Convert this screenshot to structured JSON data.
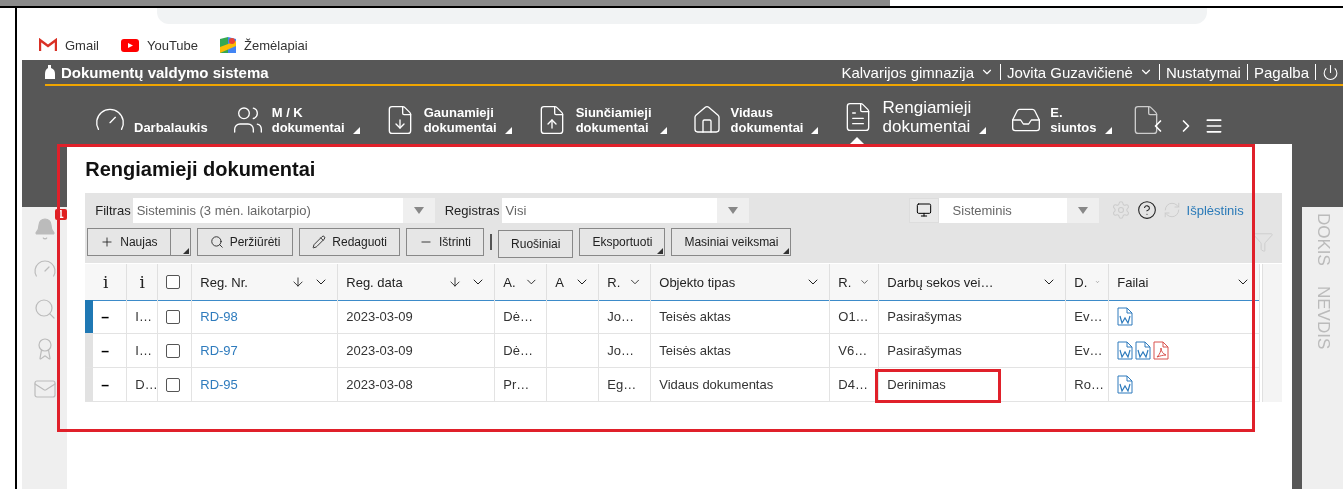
{
  "bookmarks": [
    {
      "label": "Gmail"
    },
    {
      "label": "YouTube"
    },
    {
      "label": "Žemėlapiai"
    }
  ],
  "app": {
    "title": "Dokumentų valdymo sistema",
    "header_links": [
      {
        "label": "Kalvarijos gimnazija",
        "dropdown": true
      },
      {
        "label": "Jovita Guzavičienė",
        "dropdown": true
      },
      {
        "label": "Nustatymai",
        "dropdown": false
      },
      {
        "label": "Pagalba",
        "dropdown": false
      }
    ]
  },
  "nav": [
    {
      "lines": [
        "Darbalaukis"
      ],
      "dropdown": false,
      "selected": false
    },
    {
      "lines": [
        "M / K",
        "dokumentai"
      ],
      "dropdown": true,
      "selected": false
    },
    {
      "lines": [
        "Gaunamieji",
        "dokumentai"
      ],
      "dropdown": true,
      "selected": false
    },
    {
      "lines": [
        "Siunčiamieji",
        "dokumentai"
      ],
      "dropdown": true,
      "selected": false
    },
    {
      "lines": [
        "Vidaus",
        "dokumentai"
      ],
      "dropdown": true,
      "selected": false
    },
    {
      "lines": [
        "Rengiamieji",
        "dokumentai"
      ],
      "dropdown": true,
      "selected": true
    },
    {
      "lines": [
        "E.",
        "siuntos"
      ],
      "dropdown": true,
      "selected": false
    }
  ],
  "sidebar": {
    "notification_badge": "1"
  },
  "right_sidebar": [
    "DOKIS",
    "NEVDIS"
  ],
  "page_title": "Rengiamieji dokumentai",
  "filters": {
    "filter_label": "Filtras",
    "filter_value": "Sisteminis (3 mėn. laikotarpio)",
    "register_label": "Registras",
    "register_value": "Visi",
    "view_value": "Sisteminis",
    "advanced_link": "Išplėstinis"
  },
  "toolbar": [
    {
      "label": "Naujas",
      "kind": "split"
    },
    {
      "label": "Peržiūrėti",
      "kind": "plain"
    },
    {
      "label": "Redaguoti",
      "kind": "plain"
    },
    {
      "label": "Ištrinti",
      "kind": "plain"
    },
    {
      "label": "Ruošiniai",
      "kind": "separated"
    },
    {
      "label": "Eksportuoti",
      "kind": "menu"
    },
    {
      "label": "Masiniai veiksmai",
      "kind": "menu"
    }
  ],
  "table": {
    "columns": [
      {
        "label": "i",
        "kind": "info"
      },
      {
        "label": "i",
        "kind": "info"
      },
      {
        "kind": "checkbox",
        "checked": false
      },
      {
        "label": "Reg. Nr.",
        "kind": "text",
        "sorted": true
      },
      {
        "label": "Reg. data",
        "kind": "text",
        "sorted": true
      },
      {
        "label": "A.",
        "kind": "text",
        "sorted": false
      },
      {
        "label": "A",
        "kind": "text",
        "sorted": false
      },
      {
        "label": "R.",
        "kind": "text",
        "sorted": false
      },
      {
        "label": "Objekto tipas",
        "kind": "text",
        "sorted": false
      },
      {
        "label": "R.",
        "kind": "text",
        "sorted": false
      },
      {
        "label": "Darbų sekos vei…",
        "kind": "text",
        "sorted": false
      },
      {
        "label": "D.",
        "kind": "text",
        "sorted": false
      },
      {
        "label": "Failai",
        "kind": "text",
        "sorted": false
      }
    ],
    "rows": [
      {
        "selected": true,
        "checked": false,
        "cells": [
          "–",
          "I…",
          "",
          "RD-98",
          "2023-03-09",
          "Dė…",
          "",
          "Jo…",
          "Teisės aktas",
          "O1…",
          "Pasirašymas",
          "Ev…",
          ""
        ],
        "files": [
          {
            "kind": "word"
          }
        ],
        "workflow_annotated": false
      },
      {
        "selected": false,
        "checked": false,
        "cells": [
          "–",
          "I…",
          "",
          "RD-97",
          "2023-03-09",
          "Dė…",
          "",
          "Jo…",
          "Teisės aktas",
          "V6…",
          "Pasirašymas",
          "Ev…",
          ""
        ],
        "files": [
          {
            "kind": "word"
          },
          {
            "kind": "word"
          },
          {
            "kind": "pdf"
          }
        ],
        "workflow_annotated": false
      },
      {
        "selected": false,
        "checked": false,
        "cells": [
          "–",
          "D…",
          "",
          "RD-95",
          "2023-03-08",
          "Pr…",
          "",
          "Eg…",
          "Vidaus dokumentas",
          "D4…",
          "Derinimas",
          "Ro…",
          ""
        ],
        "files": [
          {
            "kind": "word"
          }
        ],
        "workflow_annotated": true
      }
    ]
  }
}
